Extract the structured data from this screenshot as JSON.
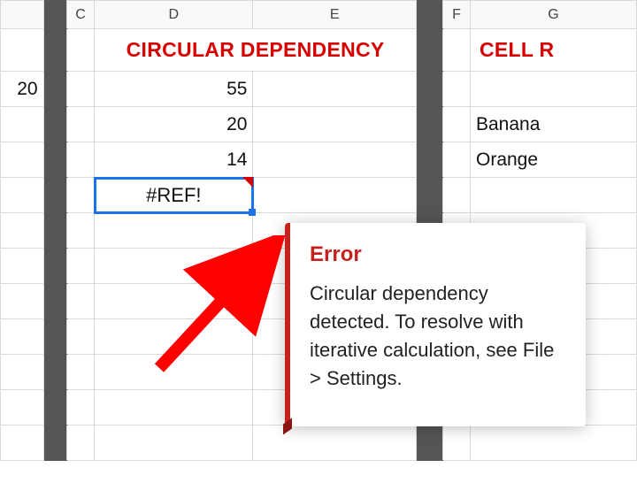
{
  "columns": {
    "c": "C",
    "d": "D",
    "e": "E",
    "f": "F",
    "g": "G"
  },
  "headers": {
    "d_e": "CIRCULAR DEPENDENCY",
    "g": "CELL R"
  },
  "cells": {
    "a2": "20",
    "d2": "55",
    "d3": "20",
    "d4": "14",
    "d5": "#REF!",
    "g3": "Banana",
    "g4": "Orange"
  },
  "error": {
    "title": "Error",
    "message": "Circular dependency detected. To resolve with iterative calculation, see File > Settings."
  }
}
